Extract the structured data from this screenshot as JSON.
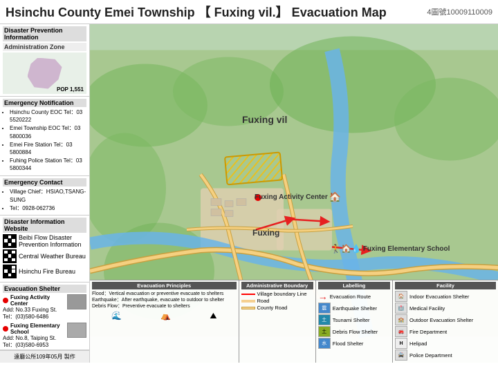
{
  "header": {
    "title": "Hsinchu County Emei Township 【 Fuxing vil.】 Evacuation Map",
    "code": "4圖號10009110009"
  },
  "sidebar": {
    "disaster_prevention_title": "Disaster Prevention Information",
    "admin_zone_title": "Administration Zone",
    "admin_zone_pop": "POP 1,551",
    "emergency_notification_title": "Emergency Notification",
    "emergency_contacts": [
      "Hsinchu County EOC Tel：03 5520222",
      "Emei Township EOC Tel：03 5800036",
      "Emei Fire Station Tel：03 5800884",
      "Fuhing Police Station Tel：03 5800344"
    ],
    "emergency_contact_title": "Emergency Contact",
    "contacts": [
      "Village Chief：HSIAO,TSANG-SUNG",
      "Tel：0928-062736"
    ],
    "disaster_info_title": "Disaster Information Website",
    "info_sites": [
      "Beibi Flow Disaster Prevention Information",
      "Central Weather Bureau",
      "Hsinchu Fire Bureau"
    ],
    "evacuation_shelter_title": "Evacuation Shelter",
    "shelters": [
      {
        "name": "Fuxing Activity Center",
        "address": "Add: No.33 Fuxing St.",
        "tel": "Tel：(03)580-6486"
      },
      {
        "name": "Fuxing Elementary School",
        "address": "Add: No.8, Taiping St.",
        "tel": "Tel：(03)580-6953"
      }
    ],
    "footer_label": "遠廳公所109年05月 製作"
  },
  "map": {
    "labels": {
      "fuxing_vil": "Fuxing vil",
      "fuxing": "Fuxing",
      "activity_center": "Fuxing Activity Center",
      "elementary_school": "Fuxing Elementary School"
    }
  },
  "legend": {
    "evacuation_principles_title": "Evacuation Principles",
    "evacuation_text": "Flood：Vertical evacuation or preventive evacuate to shelters\nEarthquake：After earthquake, evacuate to outdoor to shelter\nDebris Flow：Preventive evacuate to shelters",
    "admin_boundary_title": "Administrative Boundary",
    "boundaries": [
      {
        "label": "Village boundary Line",
        "color": "#ff0000"
      },
      {
        "label": "Road",
        "color": "#f5d090"
      },
      {
        "label": "County Road",
        "color": "#f5d090"
      }
    ],
    "labelling_title": "Labelling",
    "labellings": [
      {
        "label": "Evacuation Route",
        "type": "arrow"
      },
      {
        "label": "Earthquake Shelter 震",
        "type": "icon"
      },
      {
        "label": "Tsunami Shelter 土",
        "type": "icon"
      },
      {
        "label": "Debris Flow Shelter",
        "type": "icon"
      },
      {
        "label": "Flood Shelter",
        "type": "icon"
      }
    ],
    "facility_title": "Facility",
    "facilities": [
      {
        "label": "Indoor Evacuation Shelter",
        "icon": "🏠"
      },
      {
        "label": "Medical Facility",
        "icon": "🏥"
      },
      {
        "label": "Outdoor Evacuation Shelter",
        "icon": "🏫"
      },
      {
        "label": "Fire Department",
        "icon": "🚒"
      },
      {
        "label": "Helipad",
        "icon": "H"
      },
      {
        "label": "Police Department",
        "icon": "🚔"
      }
    ]
  }
}
